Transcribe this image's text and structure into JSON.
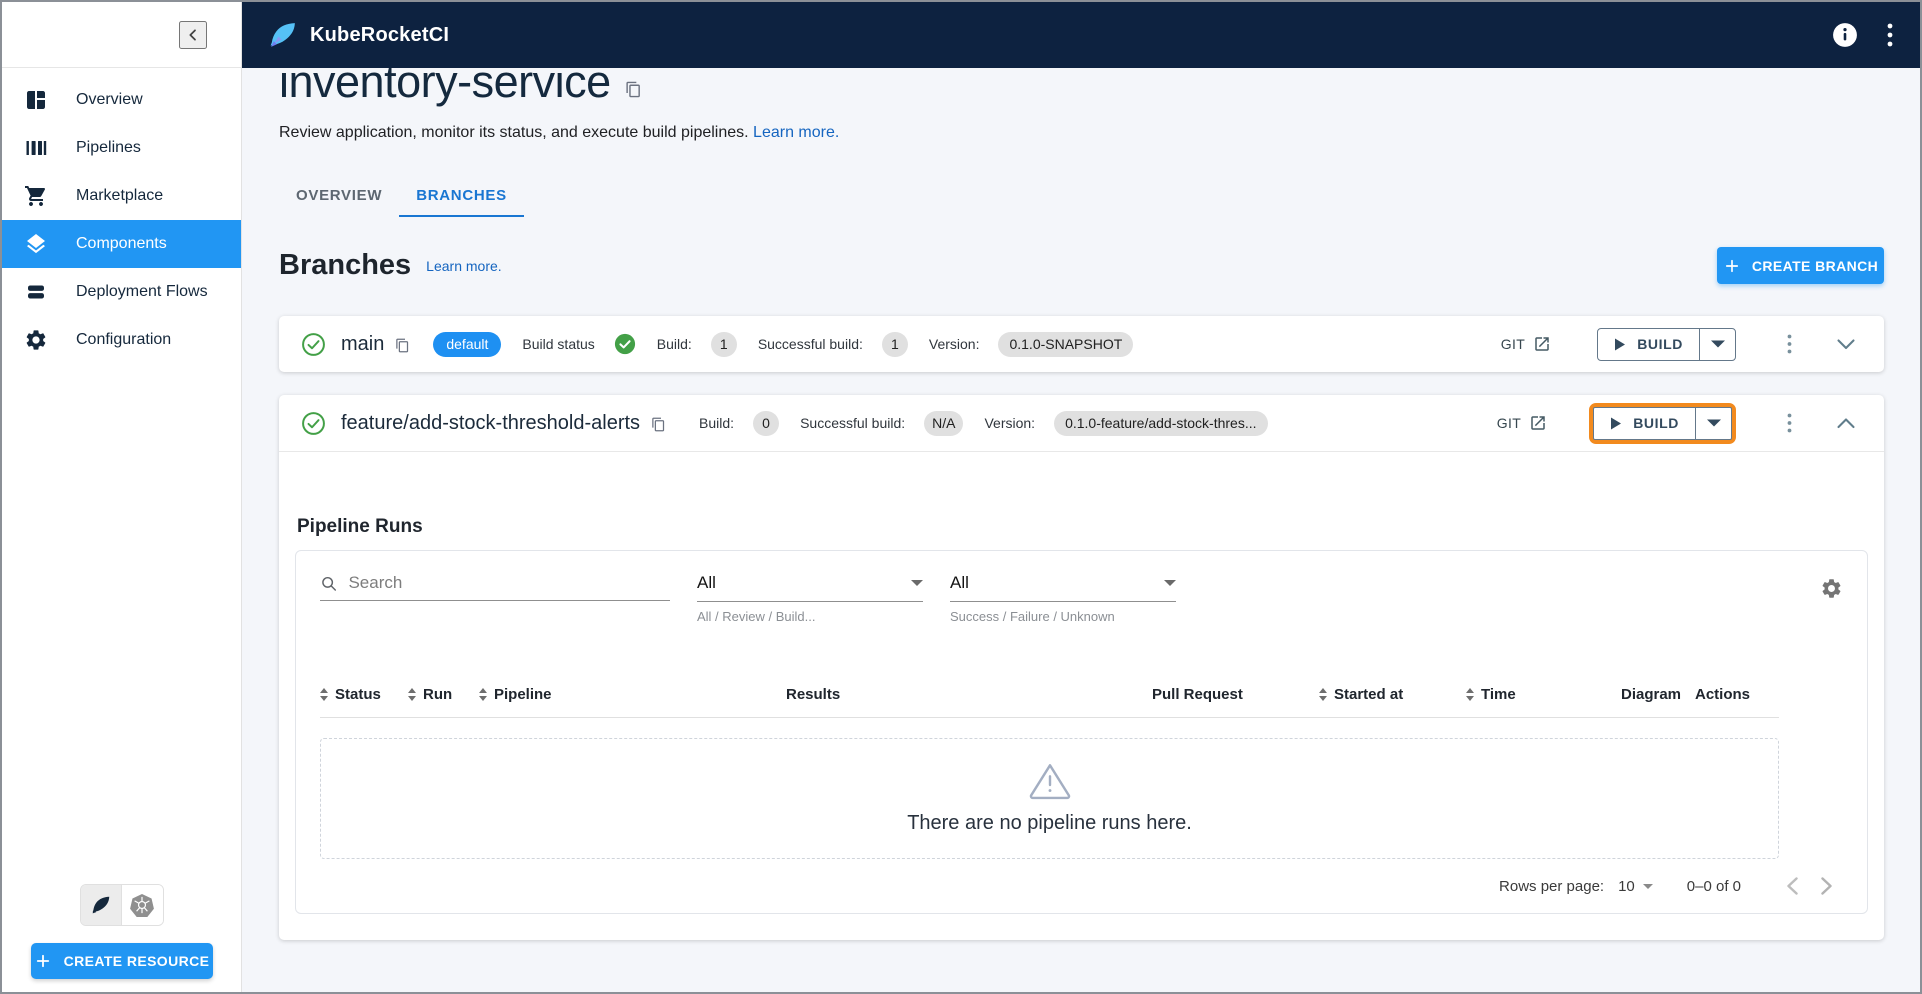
{
  "app": {
    "title": "KubeRocketCI"
  },
  "sidebar": {
    "items": [
      {
        "label": "Overview"
      },
      {
        "label": "Pipelines"
      },
      {
        "label": "Marketplace"
      },
      {
        "label": "Components"
      },
      {
        "label": "Deployment Flows"
      },
      {
        "label": "Configuration"
      }
    ],
    "create_resource_label": "CREATE RESOURCE"
  },
  "page": {
    "title": "inventory-service",
    "description": "Review application, monitor its status, and execute build pipelines.",
    "learn_more": "Learn more.",
    "tabs": [
      {
        "label": "OVERVIEW"
      },
      {
        "label": "BRANCHES"
      }
    ],
    "branches_heading": "Branches",
    "branches_learn_more": "Learn more.",
    "create_branch_label": "CREATE BRANCH"
  },
  "branches": [
    {
      "name": "main",
      "default_chip": "default",
      "build_status_label": "Build status",
      "build_label": "Build:",
      "build_value": "1",
      "successful_build_label": "Successful build:",
      "successful_build_value": "1",
      "version_label": "Version:",
      "version_value": "0.1.0-SNAPSHOT",
      "git_label": "GIT",
      "build_button_label": "BUILD"
    },
    {
      "name": "feature/add-stock-threshold-alerts",
      "build_label": "Build:",
      "build_value": "0",
      "successful_build_label": "Successful build:",
      "successful_build_value": "N/A",
      "version_label": "Version:",
      "version_value": "0.1.0-feature/add-stock-thres...",
      "git_label": "GIT",
      "build_button_label": "BUILD"
    }
  ],
  "pipeline_runs": {
    "title": "Pipeline Runs",
    "search_placeholder": "Search",
    "filter_type": {
      "value": "All",
      "helper": "All / Review / Build..."
    },
    "filter_status": {
      "value": "All",
      "helper": "Success / Failure / Unknown"
    },
    "columns": [
      {
        "label": "Status"
      },
      {
        "label": "Run"
      },
      {
        "label": "Pipeline"
      },
      {
        "label": "Results"
      },
      {
        "label": "Pull Request"
      },
      {
        "label": "Started at"
      },
      {
        "label": "Time"
      },
      {
        "label": "Diagram"
      },
      {
        "label": "Actions"
      }
    ],
    "empty_message": "There are no pipeline runs here.",
    "pagination": {
      "rows_per_page_label": "Rows per page:",
      "rows_per_page_value": "10",
      "range_label": "0–0 of 0"
    }
  },
  "colors": {
    "header_navy": "#0d2240",
    "accent_blue": "#2196f3",
    "link_blue": "#1565c0",
    "success_green": "#43a047",
    "highlight_orange": "#f28a1e"
  }
}
